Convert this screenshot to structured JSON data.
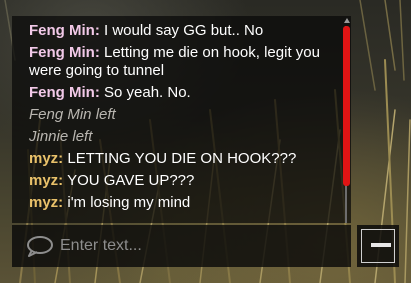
{
  "chat": {
    "messages": [
      {
        "type": "player",
        "sender": "Feng Min:",
        "text": " I would say GG but.. No",
        "name_color": "#f2c9e8"
      },
      {
        "type": "player",
        "sender": "Feng Min:",
        "text": " Letting me die on hook, legit you were going to tunnel",
        "name_color": "#f2c9e8"
      },
      {
        "type": "player",
        "sender": "Feng Min:",
        "text": " So yeah. No.",
        "name_color": "#f2c9e8"
      },
      {
        "type": "system",
        "text": "Feng Min left"
      },
      {
        "type": "system",
        "text": "Jinnie left"
      },
      {
        "type": "player",
        "sender": "myz:",
        "text": " LETTING YOU DIE ON HOOK???",
        "name_color": "#e9c16a"
      },
      {
        "type": "player",
        "sender": "myz:",
        "text": " YOU GAVE UP???",
        "name_color": "#e9c16a"
      },
      {
        "type": "player",
        "sender": "myz:",
        "text": " i'm losing my mind",
        "name_color": "#e9c16a"
      }
    ],
    "scrollbar_color": "#e01414"
  },
  "input": {
    "placeholder": "Enter text...",
    "value": ""
  },
  "icons": {
    "chat": "chat-bubble-icon",
    "keyboard": "keyboard-icon"
  }
}
